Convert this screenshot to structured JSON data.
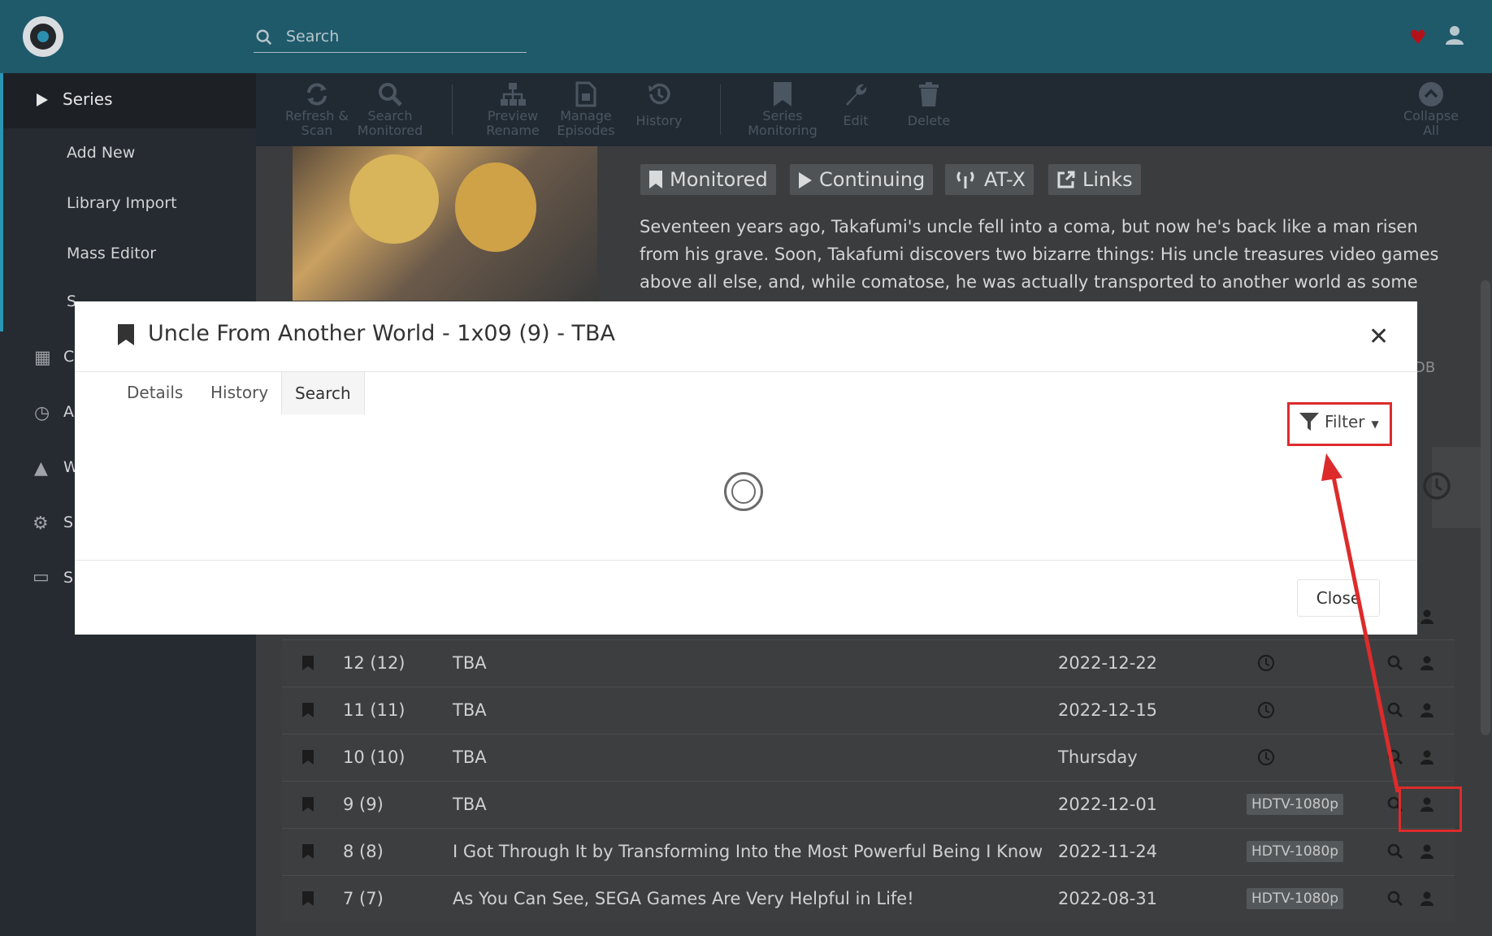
{
  "header": {
    "search_placeholder": "Search"
  },
  "sidebar": {
    "series": "Series",
    "items": [
      "Add New",
      "Library Import",
      "Mass Editor"
    ],
    "partial_letters": [
      "C",
      "A",
      "W",
      "S",
      "S"
    ]
  },
  "toolbar": {
    "buttons": [
      {
        "line1": "Refresh &",
        "line2": "Scan",
        "icon": "refresh-icon"
      },
      {
        "line1": "Search",
        "line2": "Monitored",
        "icon": "search-icon"
      },
      {
        "line1": "Preview",
        "line2": "Rename",
        "icon": "sitemap-icon"
      },
      {
        "line1": "Manage",
        "line2": "Episodes",
        "icon": "file-icon"
      },
      {
        "line1": "History",
        "line2": "",
        "icon": "history-icon"
      },
      {
        "line1": "Series",
        "line2": "Monitoring",
        "icon": "bookmark-icon"
      },
      {
        "line1": "Edit",
        "line2": "",
        "icon": "wrench-icon"
      },
      {
        "line1": "Delete",
        "line2": "",
        "icon": "trash-icon"
      },
      {
        "line1": "Collapse",
        "line2": "All",
        "icon": "chevron-up-circle-icon"
      }
    ]
  },
  "series": {
    "badges": [
      "Monitored",
      "Continuing",
      "AT-X",
      "Links"
    ],
    "overview": "Seventeen years ago, Takafumi's uncle fell into a coma, but now he's back like a man risen from his grave. Soon, Takafumi discovers two bizarre things: His uncle treasures video games above all else, and, while comatose, he was actually transported to another world as some heroic guardian! Now,",
    "link_partial": "DB"
  },
  "modal": {
    "title": "Uncle From Another World - 1x09 (9) - TBA",
    "tabs": [
      "Details",
      "History",
      "Search"
    ],
    "active_tab": "Search",
    "filter_label": "Filter",
    "close_label": "Close"
  },
  "episodes": [
    {
      "number": "12 (12)",
      "title": "TBA",
      "date": "2022-12-22",
      "status": "clock",
      "quality": ""
    },
    {
      "number": "11 (11)",
      "title": "TBA",
      "date": "2022-12-15",
      "status": "clock",
      "quality": ""
    },
    {
      "number": "10 (10)",
      "title": "TBA",
      "date": "Thursday",
      "status": "clock",
      "quality": ""
    },
    {
      "number": "9 (9)",
      "title": "TBA",
      "date": "2022-12-01",
      "status": "",
      "quality": "HDTV-1080p"
    },
    {
      "number": "8 (8)",
      "title": "I Got Through It by Transforming Into the Most Powerful Being I Know",
      "date": "2022-11-24",
      "status": "",
      "quality": "HDTV-1080p"
    },
    {
      "number": "7 (7)",
      "title": "As You Can See, SEGA Games Are Very Helpful in Life!",
      "date": "2022-08-31",
      "status": "",
      "quality": "HDTV-1080p"
    }
  ],
  "colors": {
    "header": "#1f5a6b",
    "sidebar": "#262b31",
    "accent": "#2b95b4",
    "highlight": "#dd2b2b"
  }
}
